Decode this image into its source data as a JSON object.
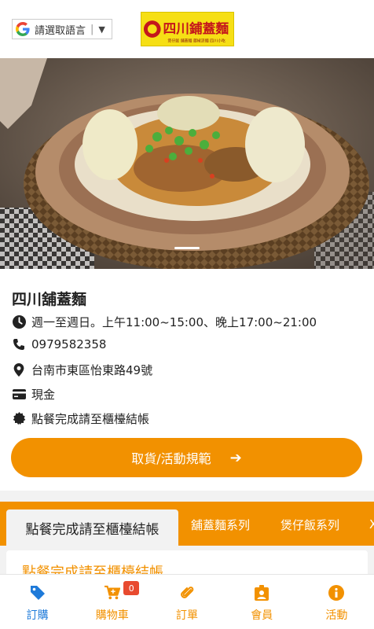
{
  "header": {
    "language_label": "請選取語言",
    "language_arrow": "▼",
    "logo_text": "四川鋪蓋麵",
    "logo_tagline": "煲仔飯 鋪蓋麵 藤椒涼麵 四川小吃"
  },
  "store": {
    "name": "四川舖蓋麵",
    "hours": "週一至週日。上午11:00~15:00、晚上17:00~21:00",
    "phone": "0979582358",
    "address": "台南市東區怡東路49號",
    "payment": "現金",
    "note": "點餐完成請至櫃檯結帳"
  },
  "cta": {
    "label": "取貨/活動規範",
    "arrow": "➔"
  },
  "tabs": [
    {
      "label": "點餐完成請至櫃檯結帳"
    },
    {
      "label": "舖蓋麵系列"
    },
    {
      "label": "煲仔飯系列"
    },
    {
      "label": "X"
    }
  ],
  "section_title": "點餐完成請至櫃檯結帳",
  "bottom_nav": [
    {
      "label": "訂購",
      "icon": "tag-icon"
    },
    {
      "label": "購物車",
      "icon": "cart-icon",
      "badge": "0"
    },
    {
      "label": "訂單",
      "icon": "paperclip-icon"
    },
    {
      "label": "會員",
      "icon": "member-badge-icon"
    },
    {
      "label": "活動",
      "icon": "info-icon"
    }
  ],
  "colors": {
    "accent": "#f29100",
    "active_nav": "#1e7ad9",
    "badge": "#e84a2f"
  }
}
